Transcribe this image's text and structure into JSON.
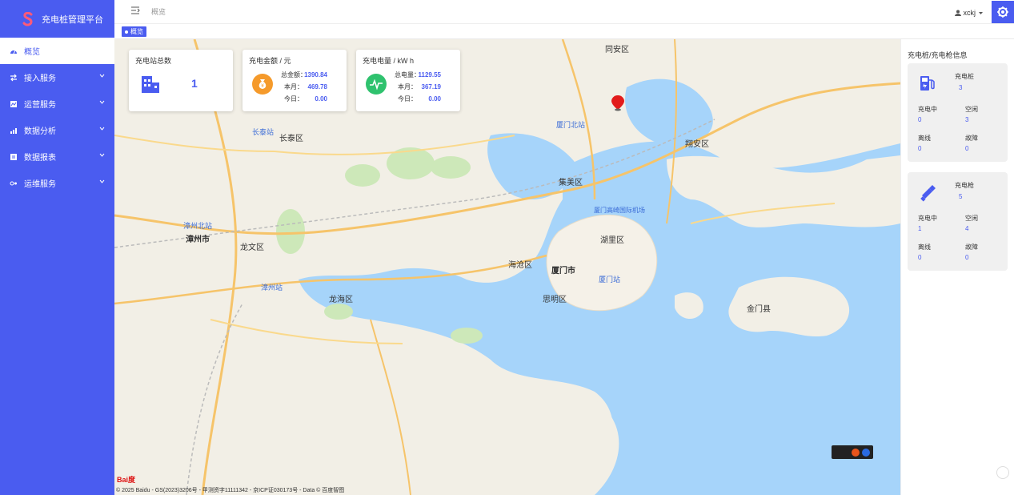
{
  "brand": {
    "title": "充电桩管理平台",
    "accent": "#4a5cf0"
  },
  "sidebar": {
    "items": [
      {
        "label": "概览",
        "icon": "dashboard-icon",
        "active": true
      },
      {
        "label": "接入服务",
        "icon": "access-icon"
      },
      {
        "label": "运营服务",
        "icon": "operation-icon"
      },
      {
        "label": "数据分析",
        "icon": "analytics-icon"
      },
      {
        "label": "数据报表",
        "icon": "report-icon"
      },
      {
        "label": "运维服务",
        "icon": "maintenance-icon"
      }
    ]
  },
  "header": {
    "breadcrumb": "概览",
    "user": "xckj"
  },
  "tagbar": {
    "tag": "概览"
  },
  "stats": {
    "stations": {
      "title": "充电站总数",
      "value": "1"
    },
    "amount": {
      "title": "充电金额 / 元",
      "total_label": "总金额：",
      "total": "1390.84",
      "month_label": "本月：",
      "month": "469.78",
      "today_label": "今日：",
      "today": "0.00"
    },
    "energy": {
      "title": "充电电量 / kW h",
      "total_label": "总电量：",
      "total": "1129.55",
      "month_label": "本月：",
      "month": "367.19",
      "today_label": "今日：",
      "today": "0.00"
    }
  },
  "right_panel": {
    "title": "充电桩/充电枪信息",
    "piles": {
      "header_label": "充电桩",
      "header_value": "3",
      "charging_label": "充电中",
      "charging": "0",
      "idle_label": "空闲",
      "idle": "3",
      "offline_label": "离线",
      "offline": "0",
      "fault_label": "故障",
      "fault": "0"
    },
    "guns": {
      "header_label": "充电枪",
      "header_value": "5",
      "charging_label": "充电中",
      "charging": "1",
      "idle_label": "空闲",
      "idle": "4",
      "offline_label": "离线",
      "offline": "0",
      "fault_label": "故障",
      "fault": "0"
    }
  },
  "map": {
    "labels": {
      "tongan": "同安区",
      "xiangan": "翔安区",
      "jimei": "集美区",
      "haicang": "海沧区",
      "xiamen": "厦门市",
      "huli": "湖里区",
      "siming": "思明区",
      "zhangzhou": "漳州市",
      "longwen": "龙文区",
      "longhai": "龙海区",
      "changtai": "长泰区",
      "jinmen": "金门县",
      "xiamen_north": "厦门北站",
      "xiamen_station": "厦门站",
      "airport": "厦门高崎国际机场",
      "zhangzhou_station": "漳州站",
      "changtai_station": "长泰站",
      "zhangzhou_north": "漳州北站"
    },
    "copyright": "© 2025 Baidu - GS(2023)3206号 - 甲测资字11111342 - 京ICP证030173号 - Data © 百度智图",
    "logo": "Bai度"
  }
}
